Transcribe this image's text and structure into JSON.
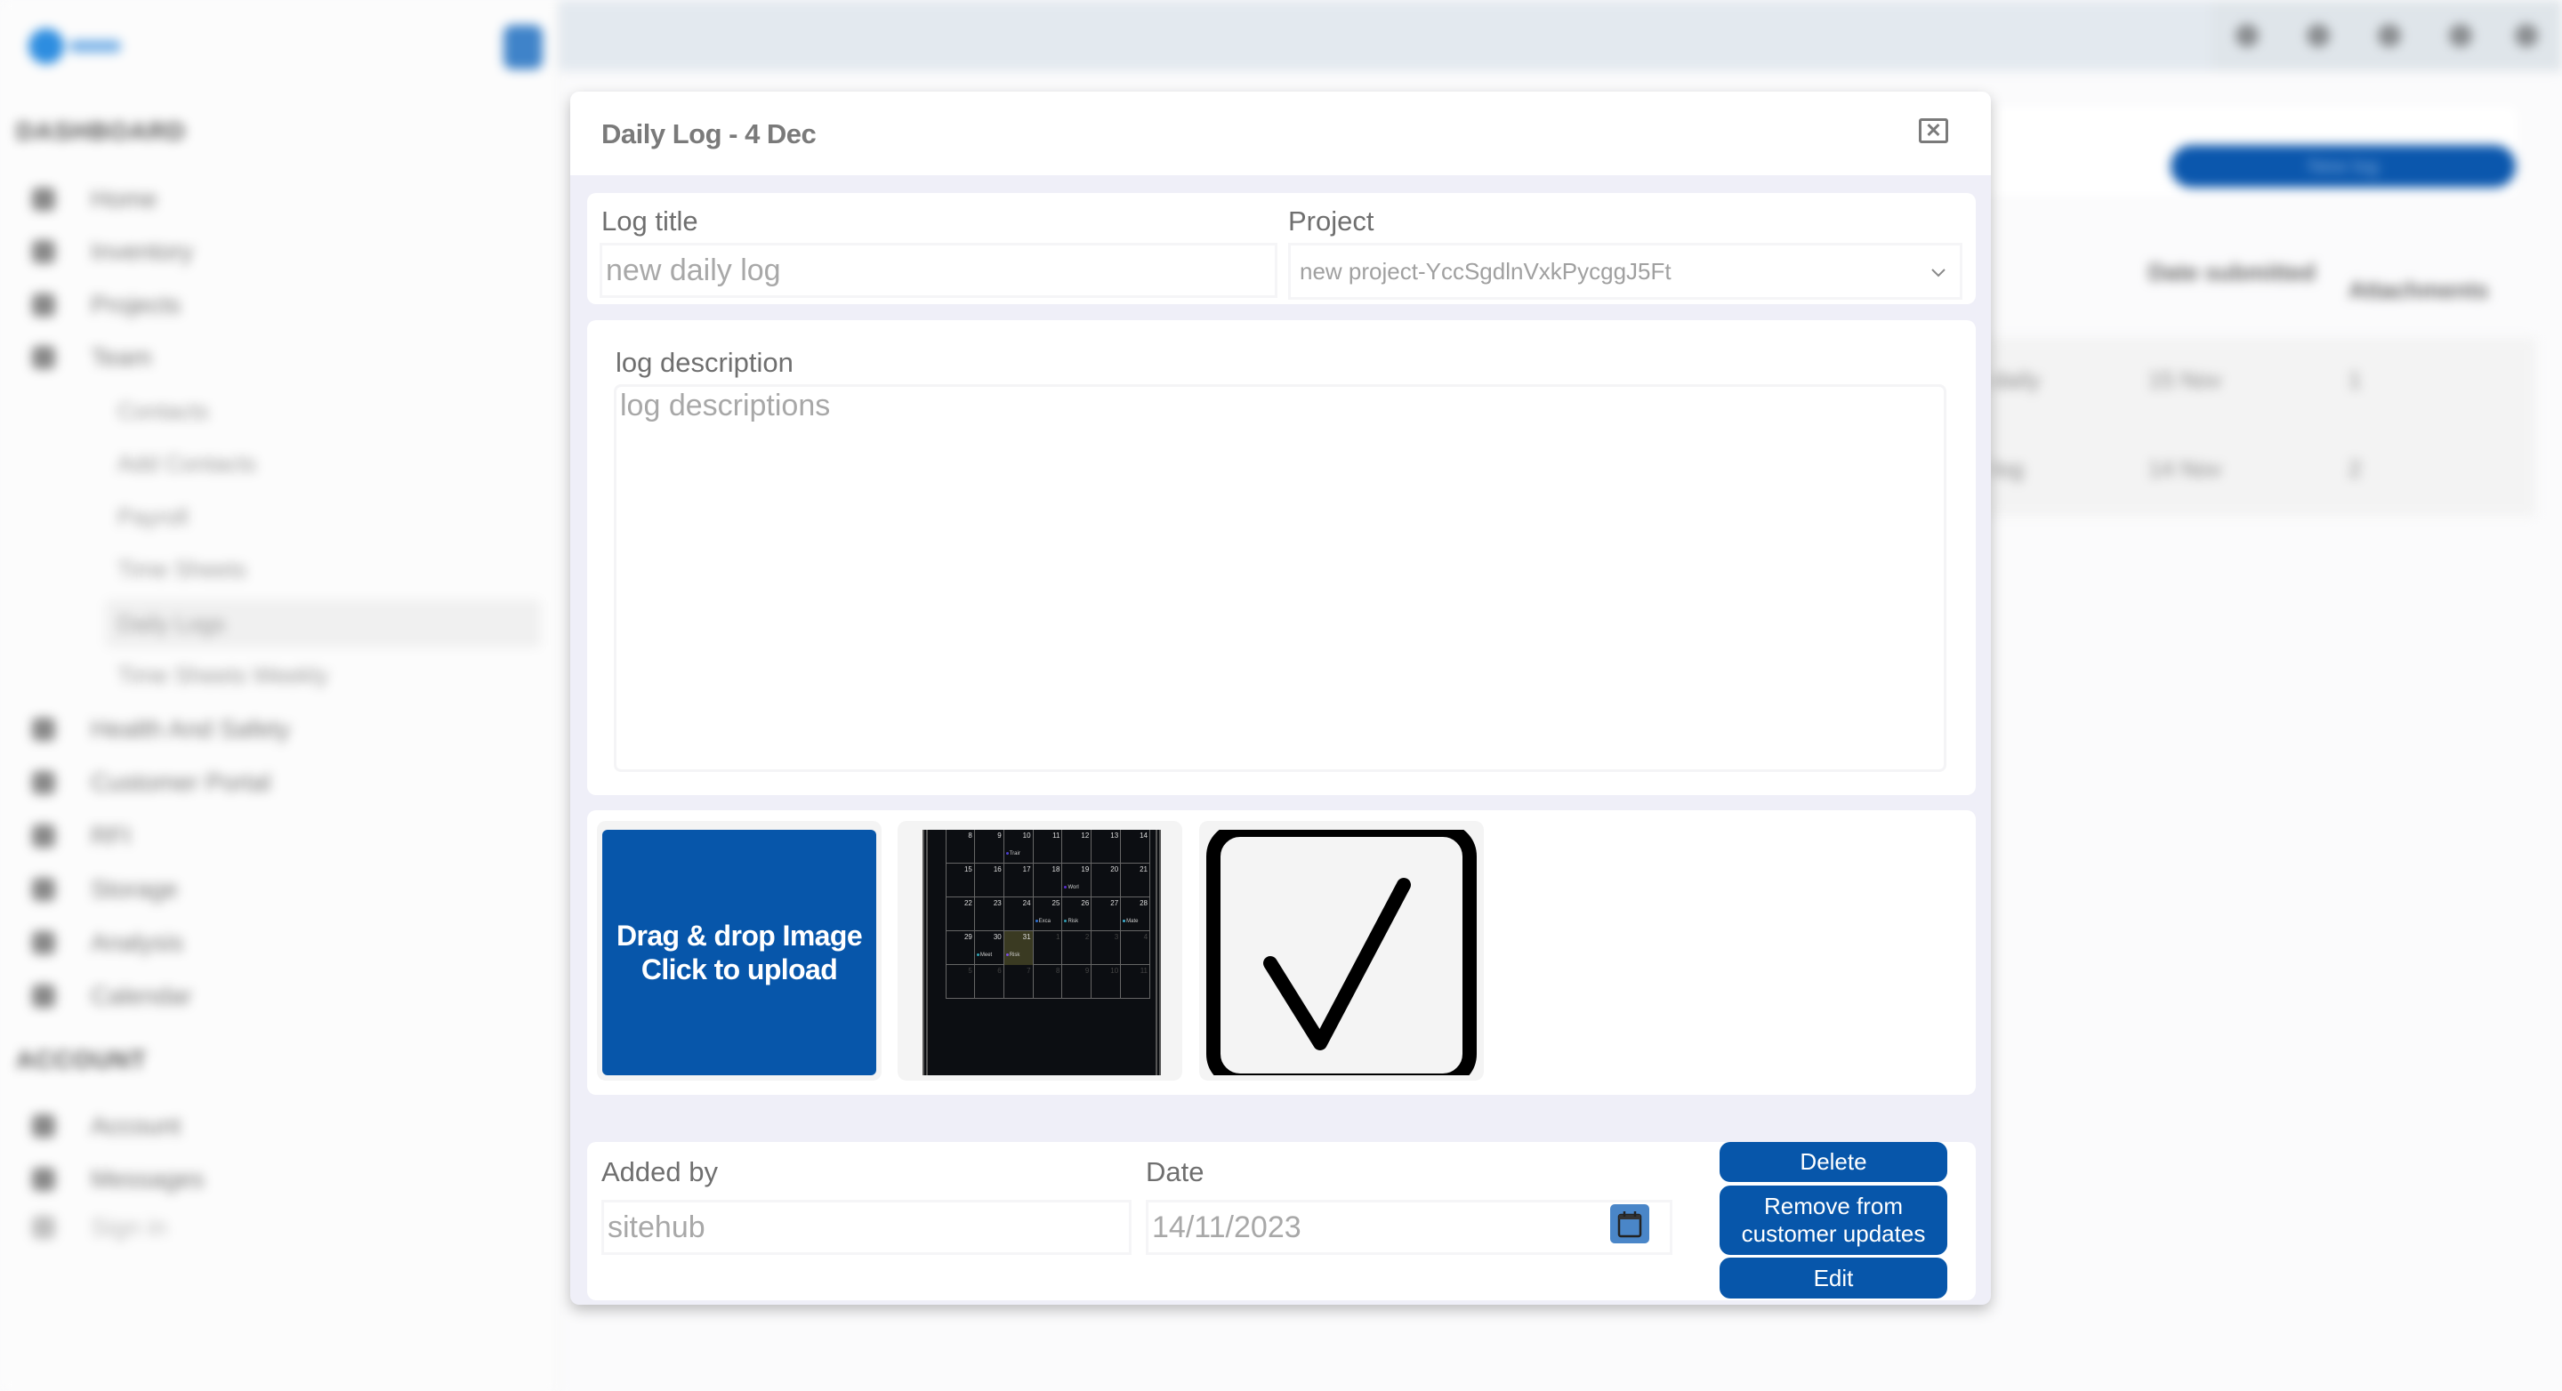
{
  "background": {
    "sidebar": {
      "sections": [
        {
          "heading": "DASHBOARD",
          "items": [
            {
              "label": "Home",
              "icon": "home-icon"
            },
            {
              "label": "Inventory",
              "icon": "inventory-icon"
            },
            {
              "label": "Projects",
              "icon": "filter-icon"
            },
            {
              "label": "Team",
              "icon": "team-icon"
            }
          ],
          "subitems": [
            "Contacts",
            "Add Contacts",
            "Payroll",
            "Time Sheets",
            "Daily Logs",
            "Time Sheets Weekly"
          ],
          "more_items": [
            {
              "label": "Health And Safety",
              "icon": "shield-icon"
            },
            {
              "label": "Customer Portal",
              "icon": "portal-icon"
            },
            {
              "label": "RFI",
              "icon": "rfi-icon"
            },
            {
              "label": "Storage",
              "icon": "storage-icon"
            },
            {
              "label": "Analysis",
              "icon": "chart-icon"
            },
            {
              "label": "Calendar",
              "icon": "calendar-icon"
            }
          ]
        },
        {
          "heading": "ACCOUNT",
          "items": [
            {
              "label": "Account",
              "icon": "user-icon"
            },
            {
              "label": "Messages",
              "icon": "mail-icon"
            },
            {
              "label": "Sign in",
              "icon": "signin-icon"
            }
          ]
        }
      ],
      "active_subitem": "Daily Logs"
    },
    "header_icons": [
      "notification-icon",
      "settings-icon",
      "mail-icon",
      "user-icon",
      "profile-icon"
    ],
    "new_log_label": "New log",
    "table": {
      "headers": [
        "Date submitted",
        "Attachments"
      ],
      "rows": [
        {
          "name": "daily",
          "date": "15 Nov",
          "attachments": "1"
        },
        {
          "name": "log",
          "date": "14 Nov",
          "attachments": "2"
        }
      ]
    }
  },
  "modal": {
    "title": "Daily Log - 4 Dec",
    "close_icon": "close-icon",
    "log_title": {
      "label": "Log title",
      "placeholder": "new daily log",
      "value": ""
    },
    "project": {
      "label": "Project",
      "selected": "new project-YccSgdlnVxkPycggJ5Ft"
    },
    "description": {
      "label": "log description",
      "placeholder": "log descriptions",
      "value": ""
    },
    "upload": {
      "line1": "Drag & drop Image",
      "line2": "Click to upload"
    },
    "attachments": [
      {
        "kind": "calendar-screenshot",
        "weeks": [
          [
            {
              "d": "8"
            },
            {
              "d": "9"
            },
            {
              "d": "10",
              "ev": "Trair",
              "c": "#4b3fcf"
            },
            {
              "d": "11"
            },
            {
              "d": "12"
            },
            {
              "d": "13"
            },
            {
              "d": "14"
            }
          ],
          [
            {
              "d": "15"
            },
            {
              "d": "16"
            },
            {
              "d": "17"
            },
            {
              "d": "18"
            },
            {
              "d": "19",
              "ev": "Worl",
              "c": "#5a2fd0"
            },
            {
              "d": "20"
            },
            {
              "d": "21"
            }
          ],
          [
            {
              "d": "22"
            },
            {
              "d": "23"
            },
            {
              "d": "24"
            },
            {
              "d": "25",
              "ev": "Exca",
              "c": "#2f6fd0"
            },
            {
              "d": "26",
              "ev": "Risk",
              "c": "#2f9ab0"
            },
            {
              "d": "27"
            },
            {
              "d": "28",
              "ev": "Mate",
              "c": "#3fb0d0"
            }
          ],
          [
            {
              "d": "29"
            },
            {
              "d": "30",
              "ev": "Meet",
              "c": "#2fa0b0"
            },
            {
              "d": "31",
              "ev": "Risk",
              "c": "#7a4fe0",
              "hl": true
            },
            {
              "d": "1",
              "dim": true
            },
            {
              "d": "2",
              "dim": true
            },
            {
              "d": "3",
              "dim": true
            },
            {
              "d": "4",
              "dim": true
            }
          ],
          [
            {
              "d": "5",
              "dim": true
            },
            {
              "d": "6",
              "dim": true
            },
            {
              "d": "7",
              "dim": true
            },
            {
              "d": "8",
              "dim": true
            },
            {
              "d": "9",
              "dim": true
            },
            {
              "d": "10",
              "dim": true
            },
            {
              "d": "11",
              "dim": true
            }
          ]
        ]
      },
      {
        "kind": "checkmark-image"
      }
    ],
    "added_by": {
      "label": "Added by",
      "value": "sitehub"
    },
    "date": {
      "label": "Date",
      "value": "14/11/2023",
      "icon": "calendar-icon"
    },
    "buttons": {
      "delete": "Delete",
      "remove": "Remove from customer updates",
      "edit": "Edit"
    }
  },
  "colors": {
    "accent": "#0756aa",
    "modal_bg": "#efeff8",
    "label_text": "#6f6f6f",
    "placeholder_text": "#a8a8a8"
  }
}
